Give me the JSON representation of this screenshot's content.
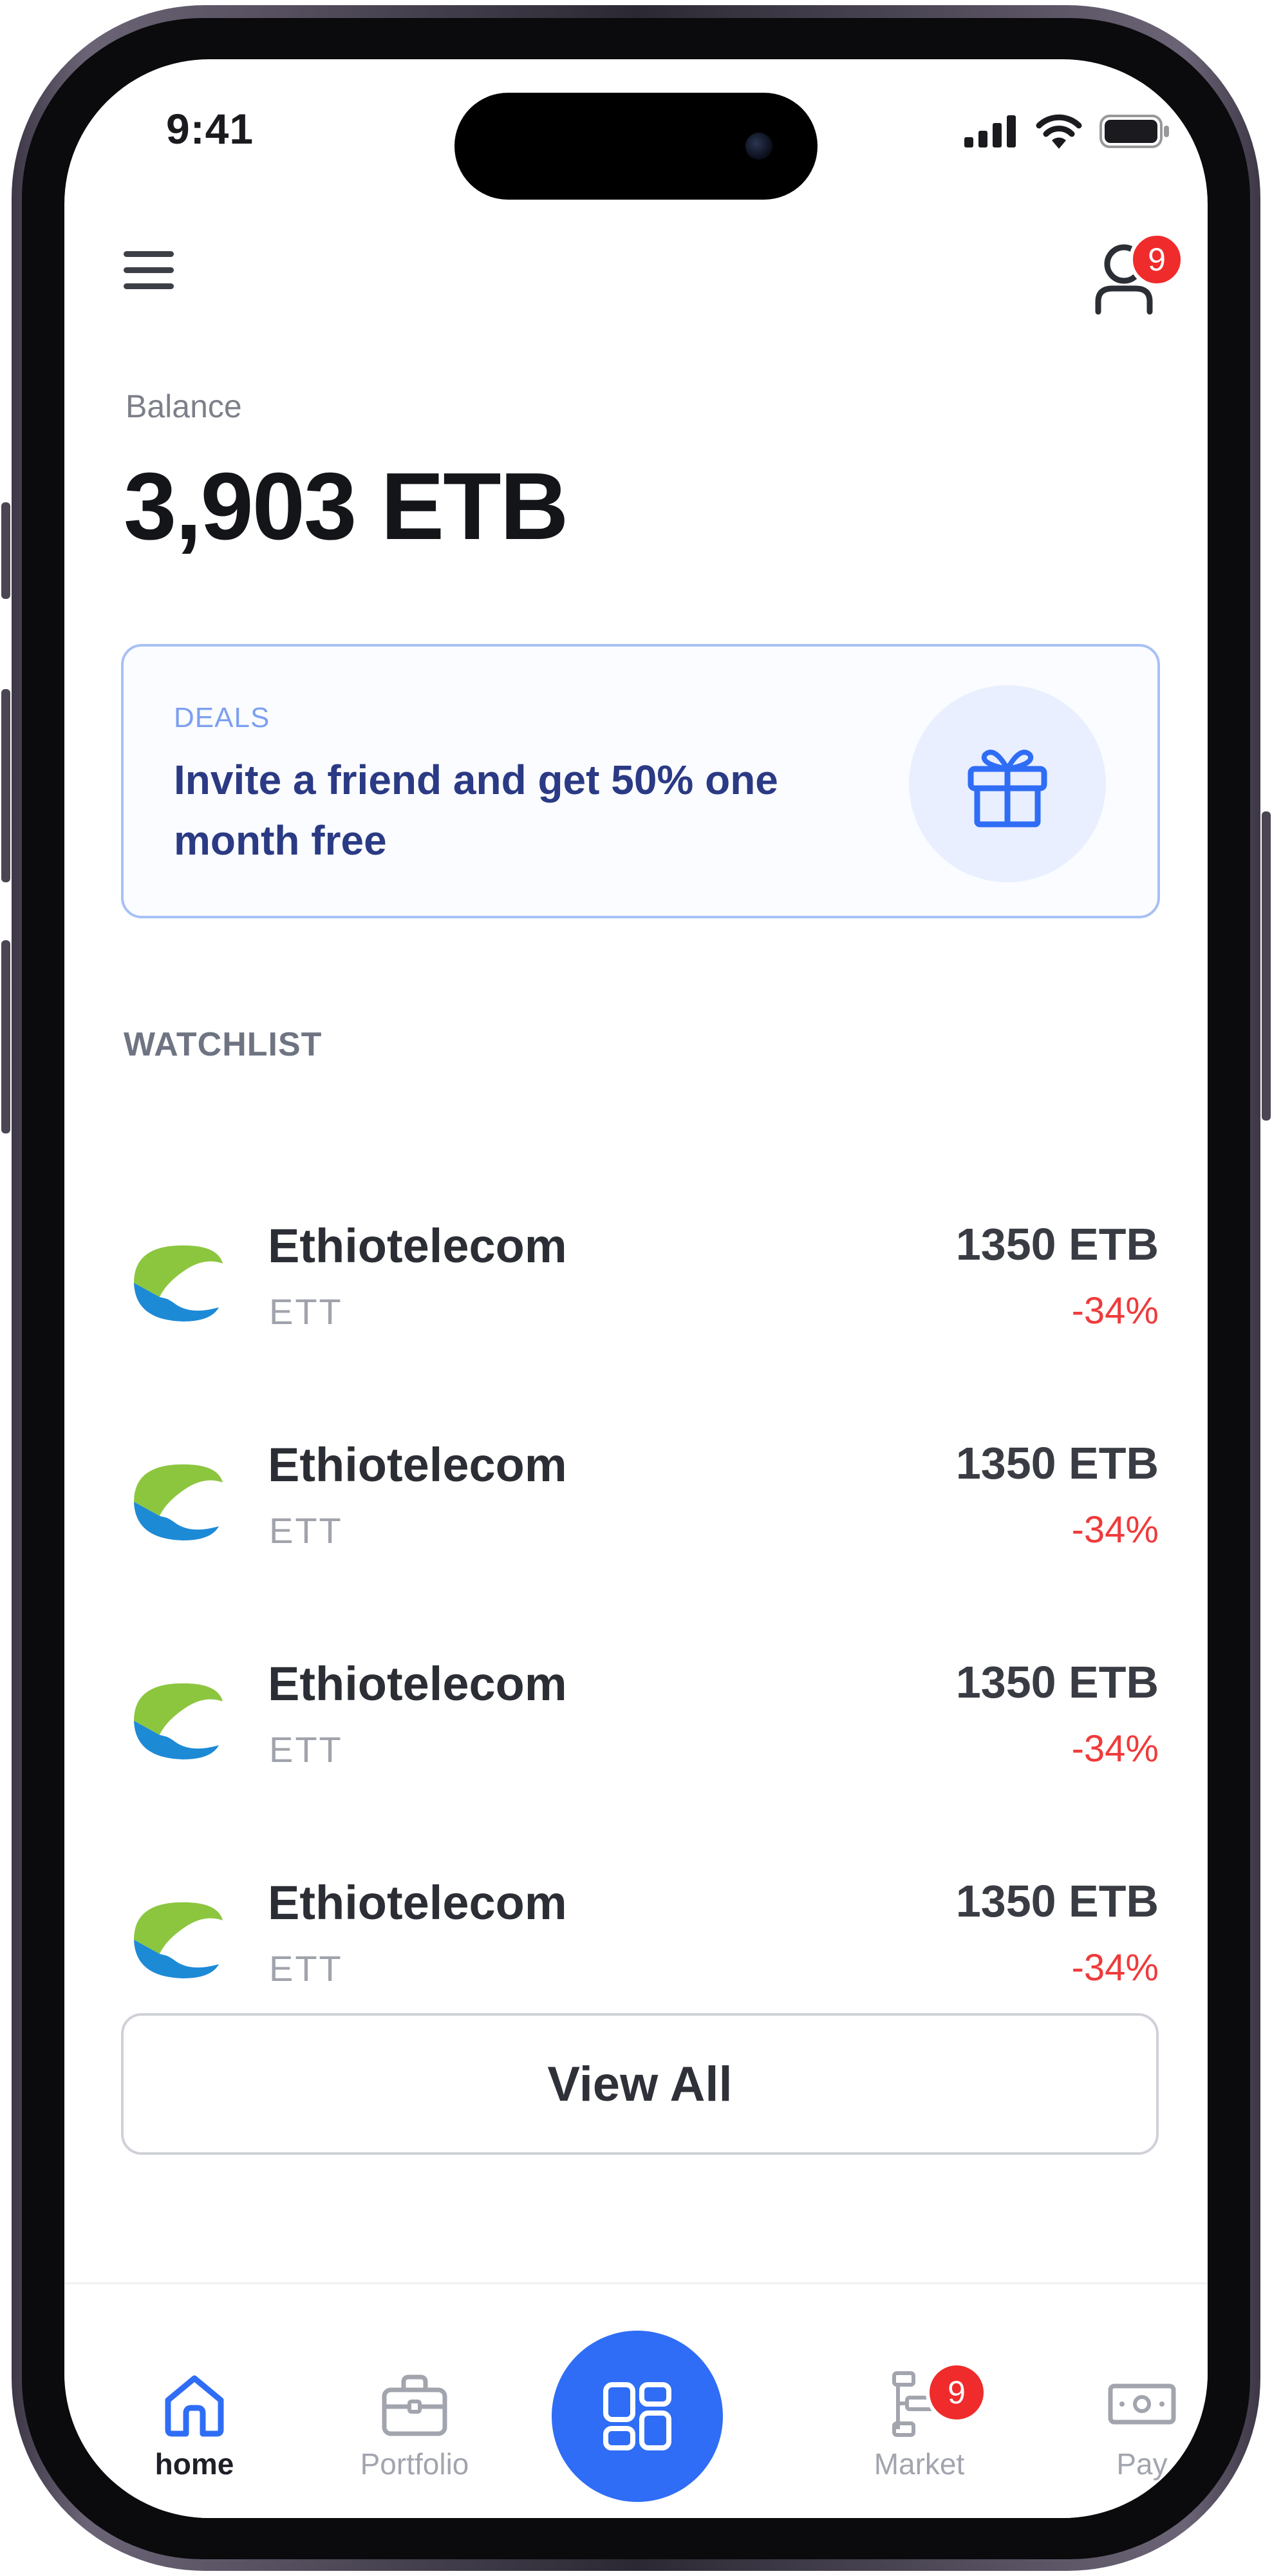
{
  "status_bar": {
    "time": "9:41"
  },
  "header": {
    "menu_icon": "hamburger-menu-icon",
    "profile_icon": "user-icon",
    "notification_count": "9"
  },
  "balance": {
    "label": "Balance",
    "value": "3,903 ETB"
  },
  "deals": {
    "tag": "DEALS",
    "text": "Invite a friend and get 50% one month free",
    "icon": "gift-icon"
  },
  "watchlist": {
    "title": "WATCHLIST",
    "items": [
      {
        "name": "Ethiotelecom",
        "symbol": "ETT",
        "price": "1350 ETB",
        "change": "-34%"
      },
      {
        "name": "Ethiotelecom",
        "symbol": "ETT",
        "price": "1350 ETB",
        "change": "-34%"
      },
      {
        "name": "Ethiotelecom",
        "symbol": "ETT",
        "price": "1350 ETB",
        "change": "-34%"
      },
      {
        "name": "Ethiotelecom",
        "symbol": "ETT",
        "price": "1350 ETB",
        "change": "-34%"
      }
    ],
    "view_all_label": "View All"
  },
  "bottom_nav": {
    "items": [
      {
        "label": "home",
        "icon": "home-icon",
        "active": true
      },
      {
        "label": "Portfolio",
        "icon": "briefcase-icon",
        "active": false
      },
      {
        "label": "Market",
        "icon": "market-icon",
        "active": false,
        "badge": "9"
      },
      {
        "label": "Pay",
        "icon": "cash-icon",
        "active": false
      }
    ],
    "center_button_icon": "apps-grid-icon"
  },
  "colors": {
    "accent": "#2f6df6",
    "negative": "#ef3b3b",
    "badge": "#ef2b2b",
    "deals_text": "#2b3a84"
  }
}
